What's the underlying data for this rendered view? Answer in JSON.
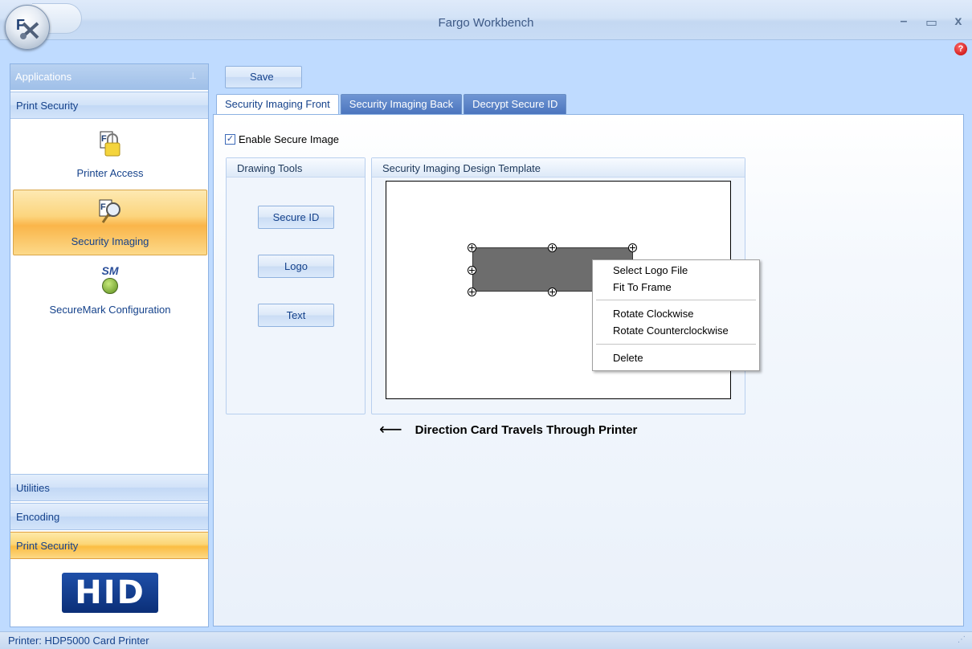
{
  "window": {
    "title": "Fargo Workbench",
    "controls": [
      "–",
      "▭",
      "x"
    ],
    "help": "?"
  },
  "toolbar": {
    "save_label": "Save"
  },
  "sidebar": {
    "header": "Applications",
    "section_title": "Print Security",
    "items": [
      {
        "label": "Printer Access",
        "icon": "lock-icon",
        "selected": false
      },
      {
        "label": "Security Imaging",
        "icon": "magnifier-icon",
        "selected": true
      },
      {
        "label": "SecureMark Configuration",
        "icon": "securemark-icon",
        "badge": "SM",
        "selected": false
      }
    ],
    "bottom_sections": [
      {
        "label": "Utilities",
        "active": false
      },
      {
        "label": "Encoding",
        "active": false
      },
      {
        "label": "Print Security",
        "active": true
      }
    ],
    "logo": "HID"
  },
  "tabs": [
    {
      "label": "Security Imaging Front",
      "active": true
    },
    {
      "label": "Security Imaging Back",
      "active": false
    },
    {
      "label": "Decrypt Secure ID",
      "active": false
    }
  ],
  "enable_secure_image": {
    "label": "Enable Secure Image",
    "checked": true
  },
  "drawing_tools": {
    "title": "Drawing Tools",
    "buttons": [
      "Secure ID",
      "Logo",
      "Text"
    ]
  },
  "design_template": {
    "title": "Security Imaging Design Template"
  },
  "context_menu": {
    "items": [
      "Select Logo File",
      "Fit To Frame",
      "Rotate Clockwise",
      "Rotate Counterclockwise",
      "Delete"
    ]
  },
  "direction": {
    "arrow": "⟵",
    "label": "Direction Card Travels Through Printer"
  },
  "status": {
    "text": "Printer:  HDP5000 Card Printer"
  },
  "colors": {
    "ribbon_blue": "#bfdbff",
    "active_orange": "#fbbd43",
    "tab_blue": "#4a74bd",
    "hid_blue": "#0b2f78"
  }
}
